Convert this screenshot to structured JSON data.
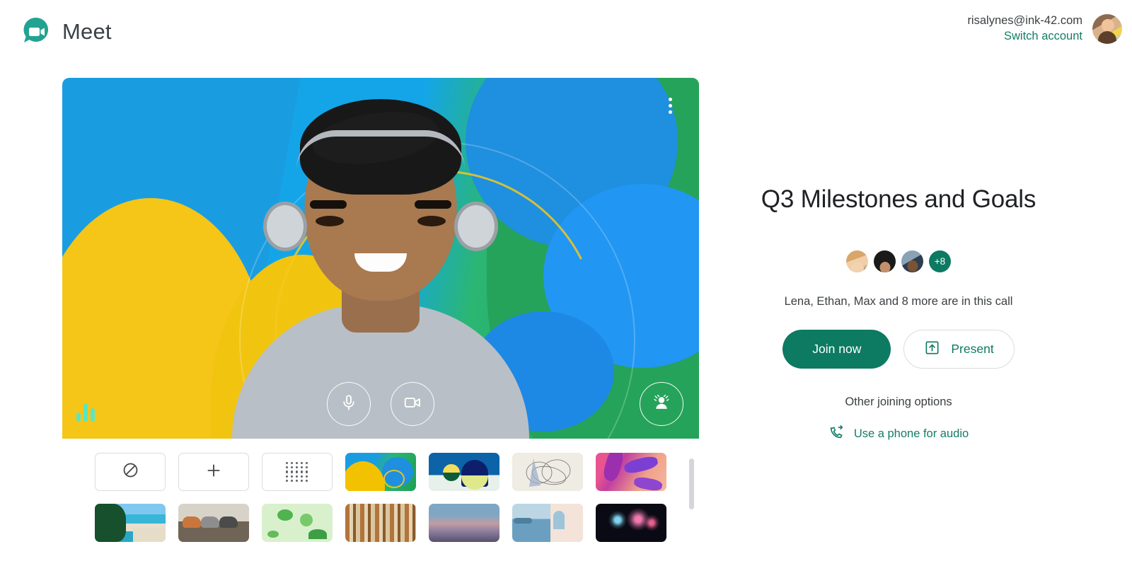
{
  "header": {
    "brand_name": "Meet",
    "brand_logo_icon": "meet-video-bubble-icon",
    "account_email": "risalynes@ink-42.com",
    "switch_account_label": "Switch account",
    "avatar_icon": "user-avatar"
  },
  "preview": {
    "more_options_icon": "more-vertical-icon",
    "audio_level_icon": "audio-level-bars-icon",
    "mic_icon": "microphone-icon",
    "camera_icon": "video-camera-icon",
    "effects_icon": "visual-effects-person-icon"
  },
  "backgrounds": {
    "tiles": [
      {
        "name": "no-effect",
        "icon": "circle-slash-icon",
        "type": "plain"
      },
      {
        "name": "add-background",
        "icon": "plus-icon",
        "type": "plain"
      },
      {
        "name": "blur-background",
        "icon": "blur-dots-icon",
        "type": "plain"
      },
      {
        "name": "yellow-blue-green-abstract",
        "type": "image"
      },
      {
        "name": "blue-sphere-abstract",
        "type": "image"
      },
      {
        "name": "wire-sketch-abstract",
        "type": "image"
      },
      {
        "name": "pink-purple-leaves",
        "type": "image"
      },
      {
        "name": "tropical-beach",
        "type": "image"
      },
      {
        "name": "running-horses",
        "type": "image"
      },
      {
        "name": "green-sea-life",
        "type": "image"
      },
      {
        "name": "bookshelf",
        "type": "image"
      },
      {
        "name": "sunset-gradient",
        "type": "image"
      },
      {
        "name": "coastal-village",
        "type": "image"
      },
      {
        "name": "fireworks",
        "type": "image"
      }
    ]
  },
  "meeting": {
    "title": "Q3 Milestones and Goals",
    "overflow_count": "+8",
    "participants_text": "Lena, Ethan, Max and 8 more are in this call",
    "join_label": "Join now",
    "present_label": "Present",
    "present_icon": "present-to-screen-icon",
    "other_options_label": "Other joining options",
    "phone_audio_label": "Use a phone for audio",
    "phone_icon": "phone-forward-icon"
  },
  "colors": {
    "brand_green": "#0d7a62",
    "link_green": "#157c68",
    "text_dark": "#3c4043"
  }
}
